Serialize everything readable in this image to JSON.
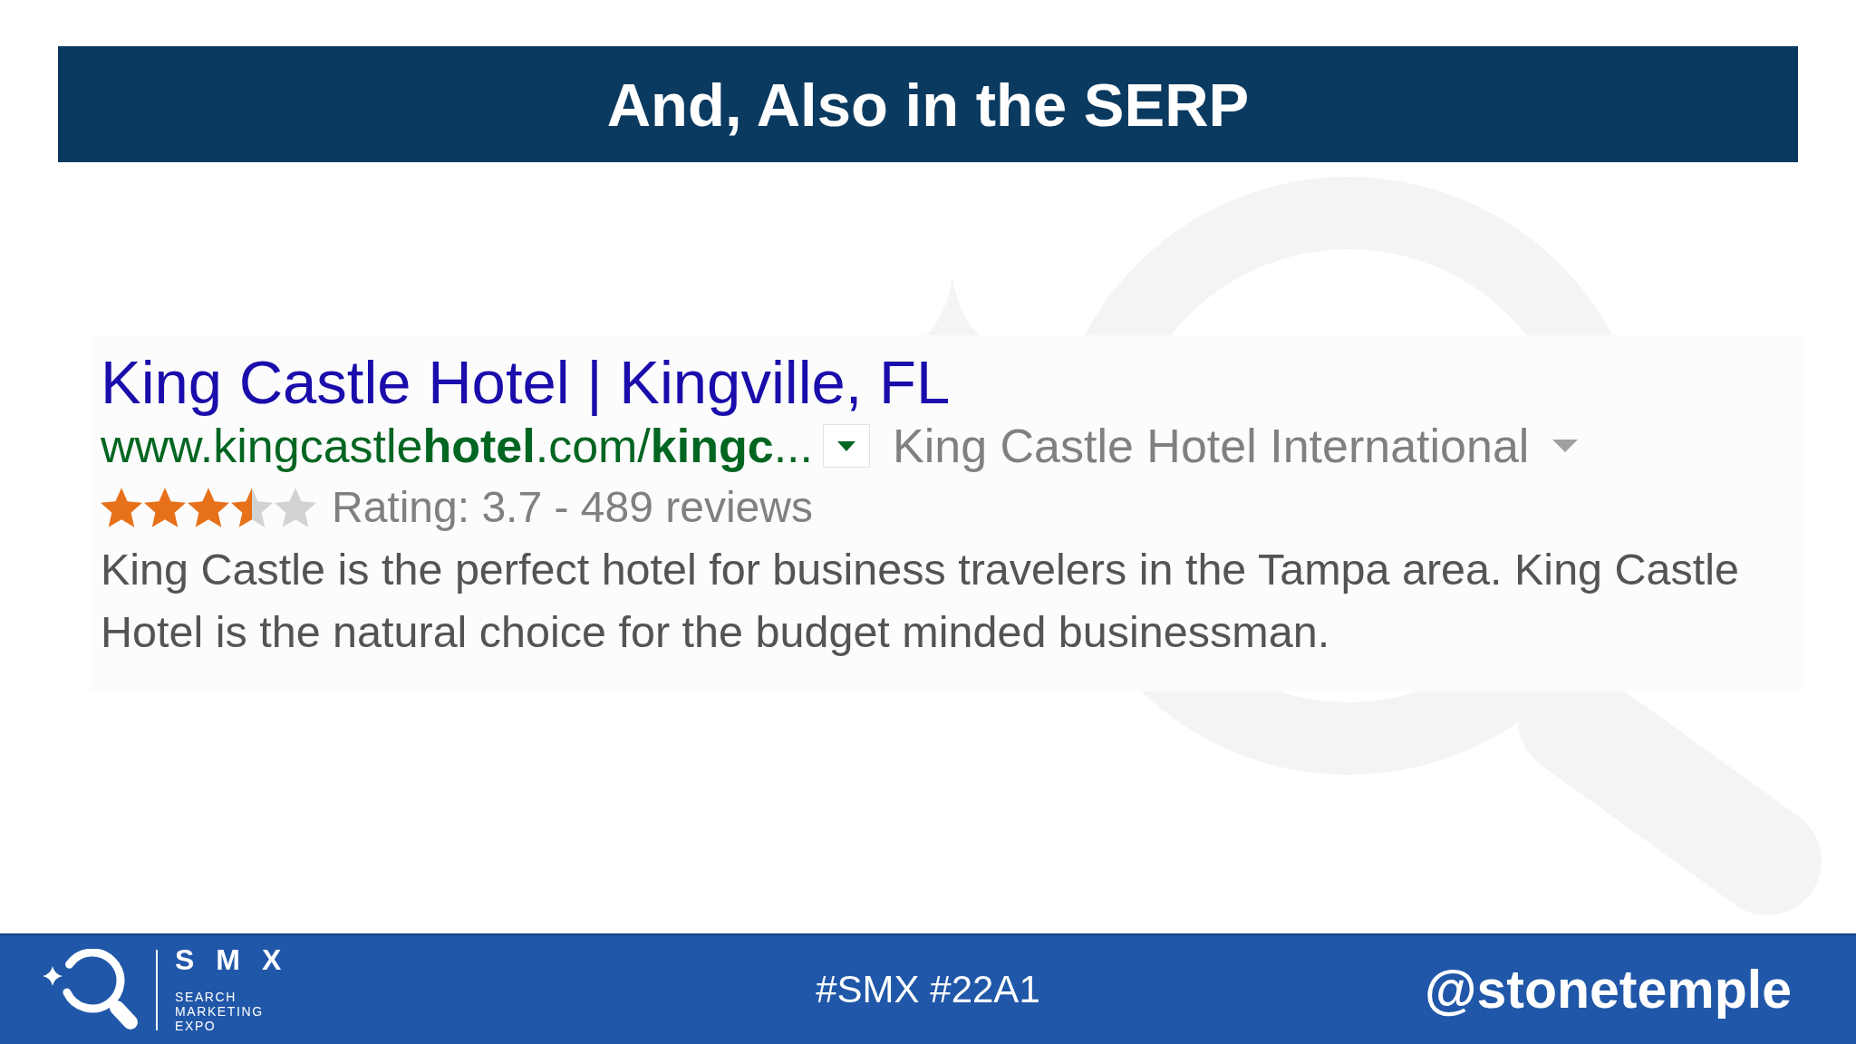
{
  "slide": {
    "title": "And, Also in the SERP"
  },
  "result": {
    "title": "King Castle Hotel | Kingville, FL",
    "url": "www.kingcastle**hotel**.com/**kingc**...",
    "publisher": "King Castle Hotel International",
    "stars": 3.5,
    "rating": "Rating: 3.7 - 489 reviews",
    "description": "King Castle is the perfect hotel for business travelers in the Tampa area. King Castle Hotel is the natural choice for the budget minded businessman."
  },
  "footer": {
    "wordmark": "SMX",
    "tagline": "SEARCH MARKETING EXPO",
    "hashtags": "#SMX #22A1",
    "handle": "@stonetemple"
  }
}
